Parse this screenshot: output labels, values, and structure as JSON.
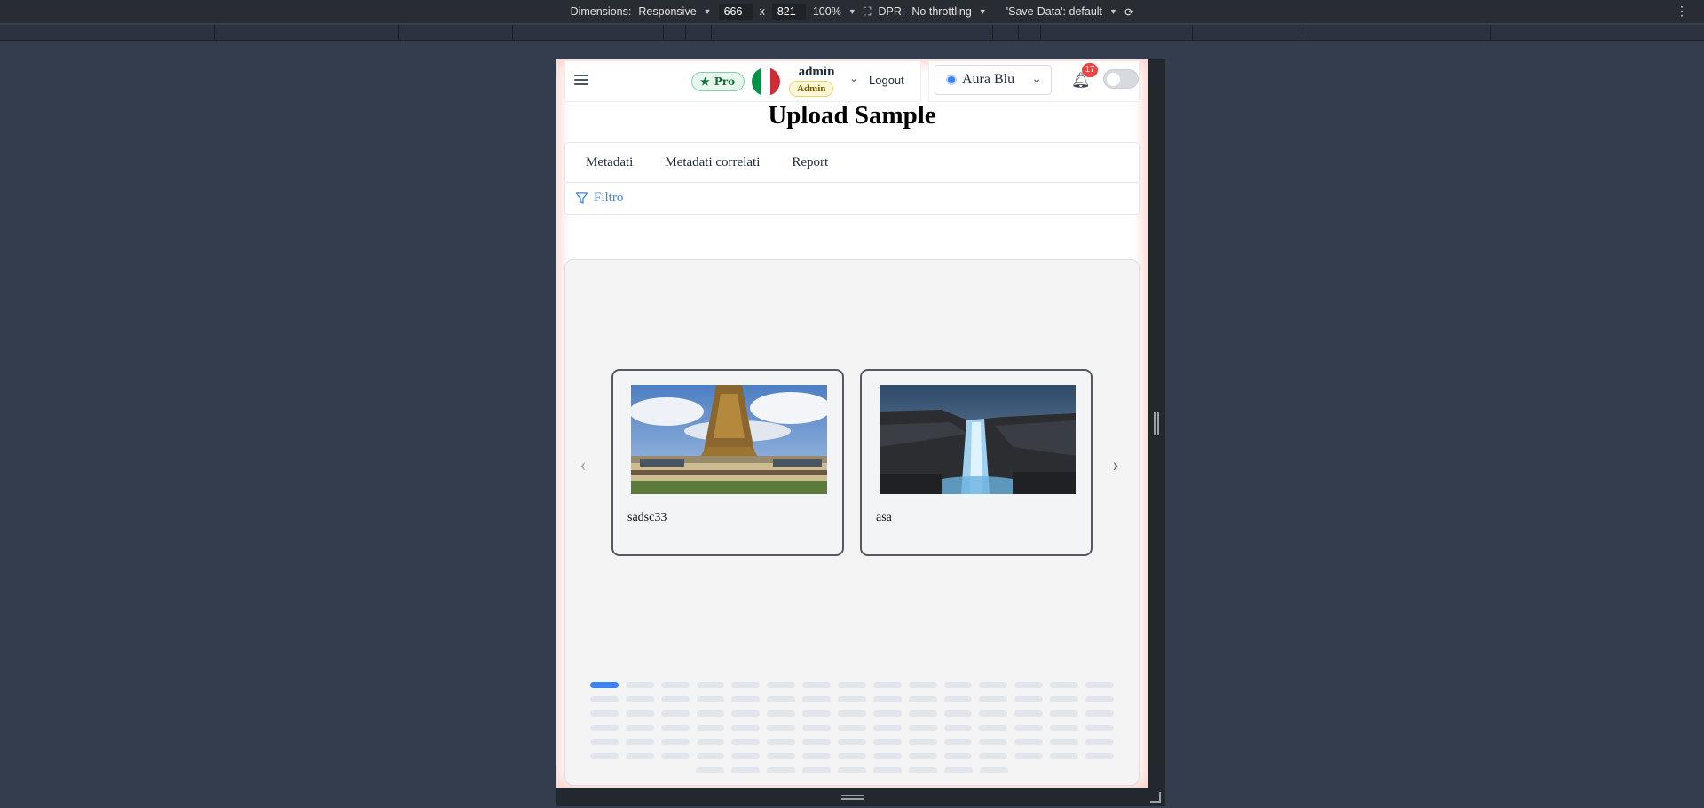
{
  "devtools": {
    "dimensions_label": "Dimensions:",
    "dimensions_mode": "Responsive",
    "width": "666",
    "times": "x",
    "height": "821",
    "zoom": "100%",
    "dpr_label": "DPR:",
    "throttling": "No throttling",
    "save_data": "'Save-Data': default"
  },
  "header": {
    "pro_label": "Pro",
    "user_name": "admin",
    "user_role": "Admin",
    "logout_label": "Logout",
    "theme_name": "Aura Blu",
    "notification_count": "17",
    "flag_colors": [
      "#009246",
      "#ffffff",
      "#ce2b37"
    ]
  },
  "page": {
    "title": "Upload Sample"
  },
  "tabs": [
    {
      "label": "Metadati"
    },
    {
      "label": "Metadati correlati"
    },
    {
      "label": "Report"
    }
  ],
  "filter": {
    "label": "Filtro"
  },
  "carousel": {
    "cards": [
      {
        "caption": "sadsc33",
        "image": "eiffel-tower-photo"
      },
      {
        "caption": "asa",
        "image": "waterfall-photo"
      }
    ],
    "dot_rows": [
      15,
      15,
      15,
      15,
      15,
      15,
      9
    ],
    "active_dot": 0
  },
  "colors": {
    "accent": "#3b82f6",
    "badge_red": "#ef4444",
    "pro_green": "#166a3f"
  }
}
